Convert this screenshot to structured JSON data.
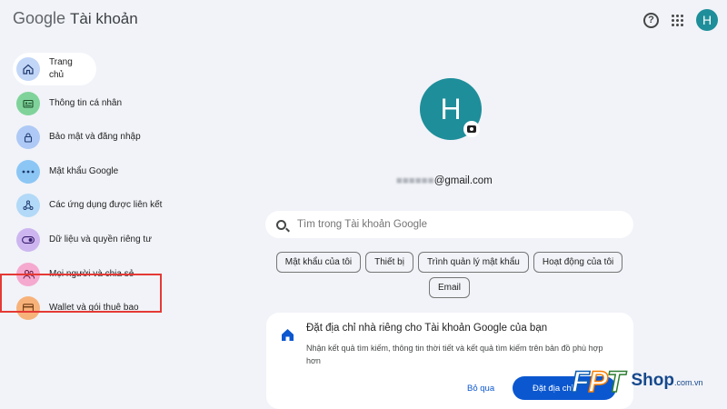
{
  "header": {
    "logo": "Google",
    "title": "Tài khoản",
    "help_icon": "help-circle-icon",
    "apps_icon": "grid-apps-icon",
    "avatar_letter": "H"
  },
  "sidebar": {
    "items": [
      {
        "label": "Trang chủ",
        "icon": "home-icon",
        "active": true
      },
      {
        "label": "Thông tin cá nhân",
        "icon": "id-card-icon"
      },
      {
        "label": "Bảo mật và đăng nhập",
        "icon": "lock-icon"
      },
      {
        "label": "Mật khẩu Google",
        "icon": "password-dots-icon"
      },
      {
        "label": "Các ứng dụng được liên kết",
        "icon": "linked-apps-icon"
      },
      {
        "label": "Dữ liệu và quyền riêng tư",
        "icon": "toggle-icon",
        "highlighted": true
      },
      {
        "label": "Mọi người và chia sẻ",
        "icon": "people-icon"
      },
      {
        "label": "Wallet và gói thuê bao",
        "icon": "wallet-icon"
      }
    ],
    "highlight_color": "#e53935"
  },
  "profile": {
    "avatar_letter": "H",
    "avatar_color": "#1e8e9a",
    "camera_icon": "camera-icon",
    "email_hidden": "■■■■■■",
    "email_domain": "@gmail.com"
  },
  "search": {
    "placeholder": "Tìm trong Tài khoản Google",
    "icon": "search-icon"
  },
  "chips": [
    "Mật khẩu của tôi",
    "Thiết bị",
    "Trình quản lý mật khẩu",
    "Hoạt động của tôi",
    "Email"
  ],
  "card": {
    "icon": "house-icon",
    "title": "Đặt địa chỉ nhà riêng cho Tài khoản Google của bạn",
    "description": "Nhận kết quả tìm kiếm, thông tin thời tiết và kết quả tìm kiếm trên bản đồ phù hợp hơn",
    "skip_label": "Bỏ qua",
    "set_label": "Đặt địa chỉ"
  },
  "watermark": {
    "brand": "FPT",
    "shop": "Shop",
    "domain": ".com.vn"
  }
}
